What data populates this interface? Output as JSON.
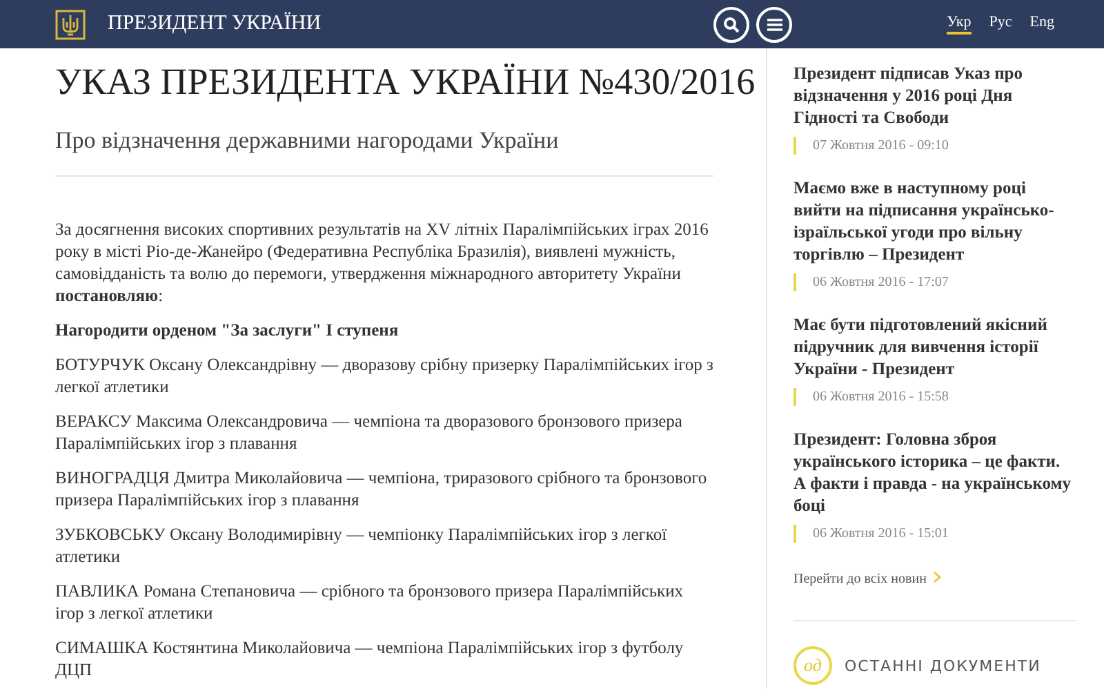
{
  "header": {
    "site_title": "ПРЕЗИДЕНТ УКРАЇНИ",
    "languages": [
      {
        "label": "Укр",
        "selected": true
      },
      {
        "label": "Рус",
        "selected": false
      },
      {
        "label": "Eng",
        "selected": false
      }
    ]
  },
  "article": {
    "title": "УКАЗ ПРЕЗИДЕНТА УКРАЇНИ №430/2016",
    "subtitle": "Про відзначення державними нагородами України",
    "intro": "За досягнення високих спортивних результатів на XV літніх Паралімпійських іграх 2016 року в місті Ріо-де-Жанейро (Федеративна Республіка Бразилія), виявлені мужність, самовідданість та волю до перемоги, утвердження міжнародного авторитету України **постановляю**:",
    "award_heading": "Нагородити орденом \"За заслуги\" I ступеня",
    "awardees": [
      "БОТУРЧУК Оксану Олександрівну — дворазову срібну призерку Паралімпійських ігор з легкої атлетики",
      "ВЕРАКСУ Максима Олександровича — чемпіона та дворазового бронзового призера Паралімпійських ігор з плавання",
      "ВИНОГРАДЦЯ Дмитра Миколайовича — чемпіона, триразового срібного та бронзового призера Паралімпійських ігор з плавання",
      "ЗУБКОВСЬКУ Оксану Володимирівну — чемпіонку Паралімпійських ігор з легкої атлетики",
      "ПАВЛИКА Романа Степановича — срібного та бронзового призера Паралімпійських ігор з легкої атлетики",
      "СИМАШКА Костянтина Миколайовича — чемпіона Паралімпійських ігор з футболу ДЦП"
    ]
  },
  "sidebar": {
    "news": [
      {
        "title": "Президент підписав Указ про відзначення у 2016 році Дня Гідності та Свободи",
        "date": "07 Жовтня 2016 - 09:10"
      },
      {
        "title": "Маємо вже в наступному році вийти на підписання українсько-ізраїльської угоди про вільну торгівлю – Президент",
        "date": "06 Жовтня 2016 - 17:07"
      },
      {
        "title": "Має бути підготовлений якісний підручник для вивчення історії України - Президент",
        "date": "06 Жовтня 2016 - 15:58"
      },
      {
        "title": "Президент: Головна зброя українського історика – це факти. А факти і правда - на українському боці",
        "date": "06 Жовтня 2016 - 15:01"
      }
    ],
    "all_news_link": "Перейти до всіх новин",
    "docs_badge": "од",
    "docs_heading": "ОСТАННІ ДОКУМЕНТИ"
  }
}
